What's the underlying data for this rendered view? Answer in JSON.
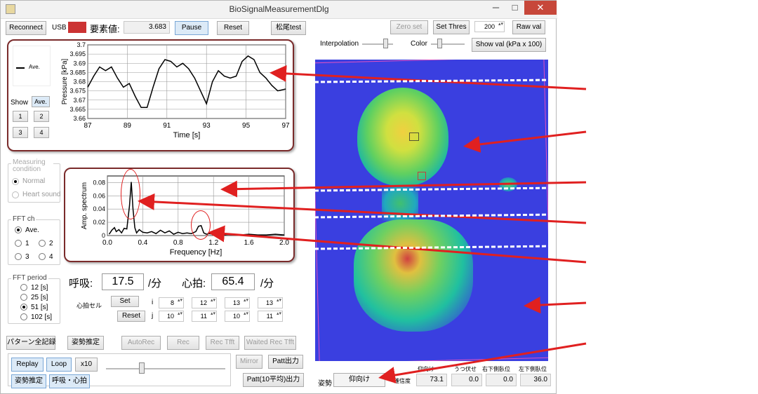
{
  "window": {
    "title": "BioSignalMeasurementDlg",
    "minimize": "─",
    "maximize": "□",
    "close": "✕"
  },
  "toolbar": {
    "reconnect": "Reconnect",
    "usb_label": "USB",
    "usb_color": "#cc3333",
    "element_label": "要素値:",
    "element_value": "3.683",
    "pause": "Pause",
    "reset": "Reset",
    "matsuo_test": "松尾test",
    "zero_set": "Zero set",
    "set_thres": "Set Thres",
    "thres_value": "200",
    "raw_val": "Raw val",
    "interpolation": "Interpolation",
    "color": "Color",
    "show_val": "Show val (kPa x 100)"
  },
  "pressure_chart": {
    "legend": "Ave.",
    "show_label": "Show",
    "show_buttons": [
      "Ave.",
      "1",
      "2",
      "3",
      "4"
    ],
    "chart_data": {
      "type": "line",
      "xlabel": "Time [s]",
      "ylabel": "Pressure [kPa]",
      "xlim": [
        87,
        97
      ],
      "ylim": [
        3.66,
        3.7
      ],
      "x_ticks": [
        "87",
        "89",
        "91",
        "93",
        "95",
        "97"
      ],
      "y_ticks": [
        "3.7",
        "3.695",
        "3.69",
        "3.685",
        "3.68",
        "3.675",
        "3.67",
        "3.665",
        "3.66"
      ],
      "series": [
        {
          "name": "Ave.",
          "x": [
            87,
            87.3,
            87.6,
            87.9,
            88.2,
            88.5,
            88.8,
            89.1,
            89.4,
            89.7,
            90,
            90.3,
            90.6,
            90.9,
            91.2,
            91.5,
            91.8,
            92.1,
            92.4,
            92.7,
            93,
            93.3,
            93.6,
            93.9,
            94.2,
            94.5,
            94.8,
            95.1,
            95.4,
            95.7,
            96,
            96.3,
            96.6,
            97
          ],
          "y": [
            3.677,
            3.683,
            3.688,
            3.686,
            3.688,
            3.682,
            3.677,
            3.679,
            3.672,
            3.666,
            3.666,
            3.677,
            3.687,
            3.692,
            3.691,
            3.688,
            3.69,
            3.687,
            3.682,
            3.675,
            3.668,
            3.68,
            3.686,
            3.683,
            3.682,
            3.683,
            3.691,
            3.694,
            3.692,
            3.685,
            3.682,
            3.678,
            3.675,
            3.676
          ]
        }
      ]
    }
  },
  "spectrum_chart": {
    "chart_data": {
      "type": "line",
      "xlabel": "Frequency [Hz]",
      "ylabel": "Amp. spectrum",
      "xlim": [
        0,
        2.0
      ],
      "ylim": [
        0,
        0.09
      ],
      "x_ticks": [
        "0.0",
        "0.4",
        "0.8",
        "1.2",
        "1.6",
        "2.0"
      ],
      "y_ticks": [
        "0.08",
        "0.06",
        "0.04",
        "0.02",
        "0"
      ],
      "series": [
        {
          "name": "Ave.",
          "x": [
            0.02,
            0.05,
            0.08,
            0.1,
            0.13,
            0.16,
            0.19,
            0.22,
            0.25,
            0.27,
            0.29,
            0.31,
            0.33,
            0.36,
            0.4,
            0.45,
            0.5,
            0.55,
            0.6,
            0.65,
            0.7,
            0.75,
            0.8,
            0.85,
            0.9,
            0.95,
            1.0,
            1.03,
            1.06,
            1.09,
            1.12,
            1.15,
            1.2,
            1.3,
            1.4,
            1.5,
            1.6,
            1.7,
            1.8,
            1.9,
            2.0
          ],
          "y": [
            0.002,
            0.008,
            0.012,
            0.006,
            0.009,
            0.004,
            0.011,
            0.01,
            0.045,
            0.081,
            0.04,
            0.012,
            0.004,
            0.009,
            0.005,
            0.004,
            0.006,
            0.003,
            0.008,
            0.004,
            0.007,
            0.002,
            0.005,
            0.003,
            0.004,
            0.003,
            0.006,
            0.014,
            0.015,
            0.004,
            0.002,
            0.003,
            0.002,
            0.001,
            0.002,
            0.001,
            0.002,
            0.001,
            0.001,
            0.002,
            0.001
          ]
        }
      ]
    }
  },
  "measuring": {
    "title": "Measuring condition",
    "normal": "Normal",
    "heart": "Heart sound"
  },
  "fft_ch": {
    "title": "FFT ch",
    "options": [
      "Ave.",
      "1",
      "2",
      "3",
      "4"
    ],
    "selected": "Ave."
  },
  "fft_period": {
    "title": "FFT period",
    "options": [
      "12 [s]",
      "25 [s]",
      "51 [s]",
      "102 [s]"
    ],
    "selected": "51 [s]"
  },
  "rates": {
    "breath_label": "呼吸:",
    "breath_value": "17.5",
    "breath_unit": "/分",
    "heart_label": "心拍:",
    "heart_value": "65.4",
    "heart_unit": "/分"
  },
  "heart_cell": {
    "label": "心拍セル",
    "set": "Set",
    "reset": "Reset",
    "i_label": "i",
    "j_label": "j",
    "i_values": [
      "8",
      "12",
      "13",
      "13"
    ],
    "j_values": [
      "10",
      "11",
      "10",
      "11"
    ]
  },
  "buttons": {
    "pattern_all": "パターン全記録",
    "posture_est": "姿勢推定",
    "autorec": "AutoRec",
    "rec": "Rec",
    "rec_tfft": "Rec Tfft",
    "waited_rec": "Waited Rec Tfft",
    "replay": "Replay",
    "loop": "Loop",
    "x10": "x10",
    "mirror": "Mirror",
    "patt_out": "Patt出力",
    "posture_est2": "姿勢推定",
    "breath_heart": "呼吸・心拍",
    "patt10": "Patt(10平均)出力"
  },
  "posture": {
    "label": "姿勢",
    "value": "仰向け",
    "reliability_label": "確信度",
    "columns": [
      "仰向け",
      "うつ伏せ",
      "右下側臥位",
      "左下側臥位"
    ],
    "values": [
      "73.1",
      "0.0",
      "0.0",
      "36.0"
    ]
  },
  "colors": {
    "heatmap_bg": "#3a3fe0",
    "frame": "#7a2b2b",
    "arrow": "#e02020"
  }
}
